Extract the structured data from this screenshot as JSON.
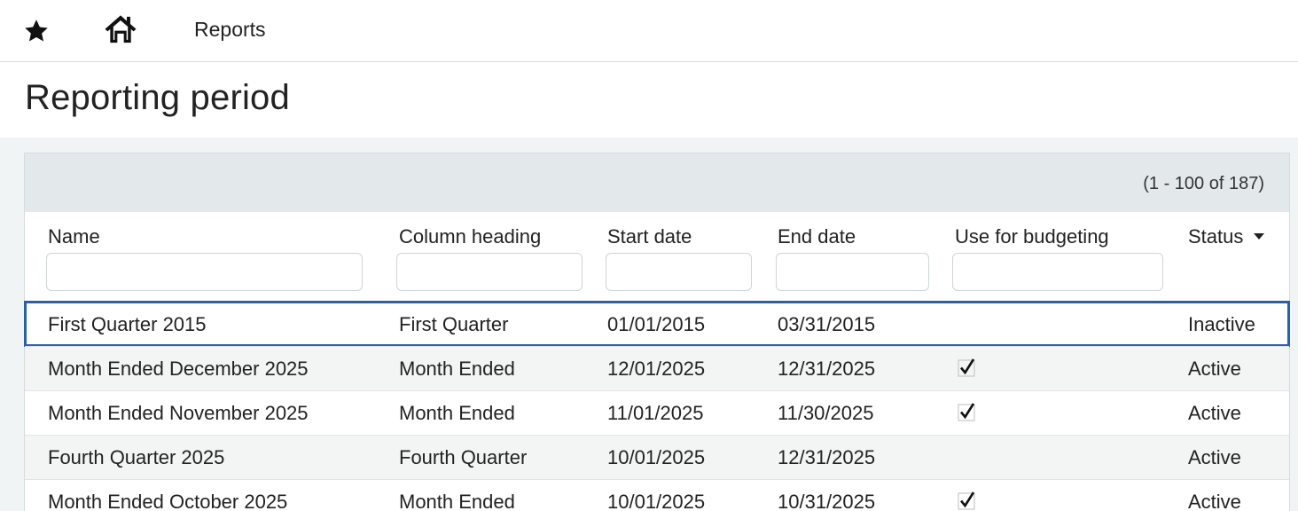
{
  "nav": {
    "star_icon": "star-icon",
    "home_icon": "home-icon",
    "reports_label": "Reports"
  },
  "page": {
    "title": "Reporting period"
  },
  "grid": {
    "pager_text": "(1 - 100 of 187)",
    "columns": {
      "name": "Name",
      "column_heading": "Column heading",
      "start_date": "Start date",
      "end_date": "End date",
      "use_for_budgeting": "Use for budgeting",
      "status": "Status"
    },
    "rows": [
      {
        "name": "First Quarter 2015",
        "column_heading": "First Quarter",
        "start_date": "01/01/2015",
        "end_date": "03/31/2015",
        "use_for_budgeting": false,
        "status": "Inactive",
        "selected": true
      },
      {
        "name": "Month Ended December 2025",
        "column_heading": "Month Ended",
        "start_date": "12/01/2025",
        "end_date": "12/31/2025",
        "use_for_budgeting": true,
        "status": "Active"
      },
      {
        "name": "Month Ended November 2025",
        "column_heading": "Month Ended",
        "start_date": "11/01/2025",
        "end_date": "11/30/2025",
        "use_for_budgeting": true,
        "status": "Active"
      },
      {
        "name": "Fourth Quarter 2025",
        "column_heading": "Fourth Quarter",
        "start_date": "10/01/2025",
        "end_date": "12/31/2025",
        "use_for_budgeting": false,
        "status": "Active"
      },
      {
        "name": "Month Ended October 2025",
        "column_heading": "Month Ended",
        "start_date": "10/01/2025",
        "end_date": "10/31/2025",
        "use_for_budgeting": true,
        "status": "Active"
      }
    ]
  },
  "colors": {
    "selection_outline": "#2d5fa8",
    "toolbar_bg": "#e3e9ea",
    "content_bg": "#f1f4f4"
  }
}
